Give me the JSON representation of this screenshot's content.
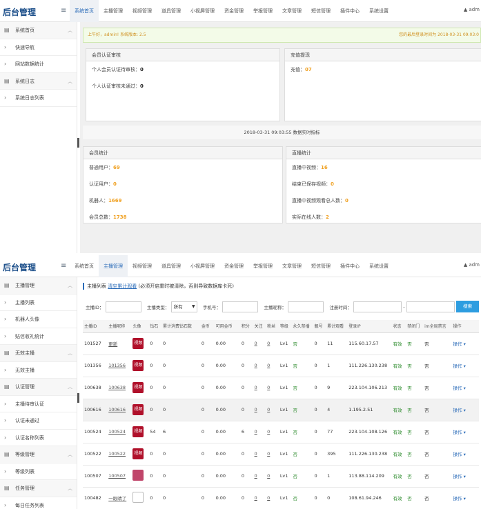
{
  "shot1": {
    "brand": "后台管理",
    "menu_icon": "hamburger-icon",
    "tabs": [
      "系统首页",
      "主播管理",
      "视频管理",
      "道具管理",
      "小视屏管理",
      "资金管理",
      "举报管理",
      "文章管理",
      "短信管理",
      "插件中心",
      "系统设置"
    ],
    "active_tab": 0,
    "user": "adm",
    "sidebar": [
      {
        "label": "系统首页",
        "type": "group",
        "icon": "doc-icon",
        "caret": "^"
      },
      {
        "label": "快速导航",
        "type": "item",
        "icon": ">"
      },
      {
        "label": "网站数据统计",
        "type": "item",
        "icon": ">"
      },
      {
        "label": "系统日志",
        "type": "group",
        "icon": "doc-icon",
        "caret": "^"
      },
      {
        "label": "系统日志列表",
        "type": "item",
        "icon": ">"
      }
    ],
    "notice_left": "上午好，admin! 系统版本: 2.5",
    "notice_right": "您的最后登录时间为 2018-03-31 09:03:0",
    "member_verify": {
      "title": "会员认证审核",
      "rows": [
        {
          "label": "个人会员认证待审核：",
          "value": "0"
        },
        {
          "label": "个人认证审核未通过：",
          "value": "0"
        }
      ]
    },
    "recharge": {
      "title": "充值提现",
      "label": "充值：",
      "value": "07"
    },
    "timestamp": "2018-03-31 09:03:55 数据实时指标",
    "member_stats": {
      "title": "会员统计",
      "rows": [
        {
          "label": "普通用户：",
          "value": "69"
        },
        {
          "label": "认证用户：",
          "value": "0"
        },
        {
          "label": "机器人：",
          "value": "1669"
        },
        {
          "label": "会员总数：",
          "value": "1738"
        }
      ]
    },
    "live_stats": {
      "title": "直播统计",
      "rows": [
        {
          "label": "直播中视频：",
          "value": "16"
        },
        {
          "label": "结束已保存视频：",
          "value": "0"
        },
        {
          "label": "直播中视频观看总人数：",
          "value": "0"
        },
        {
          "label": "实际在线人数：",
          "value": "2"
        }
      ]
    }
  },
  "shot2": {
    "brand": "后台管理",
    "tabs": [
      "系统首页",
      "主播管理",
      "视频管理",
      "道具管理",
      "小视屏管理",
      "资金管理",
      "举报管理",
      "文章管理",
      "短信管理",
      "插件中心",
      "系统设置"
    ],
    "active_tab": 1,
    "user": "adm",
    "sidebar": [
      {
        "label": "主播管理",
        "type": "group",
        "icon": "doc-icon",
        "caret": "^"
      },
      {
        "label": "主播列表",
        "type": "item",
        "icon": ">"
      },
      {
        "label": "机器人头像",
        "type": "item",
        "icon": ">"
      },
      {
        "label": "贴信收礼统计",
        "type": "item",
        "icon": ">"
      },
      {
        "label": "无效主播",
        "type": "group",
        "icon": "doc-icon",
        "caret": "^"
      },
      {
        "label": "无效主播",
        "type": "item",
        "icon": ">"
      },
      {
        "label": "认证管理",
        "type": "group",
        "icon": "doc-icon",
        "caret": "^"
      },
      {
        "label": "主播待审认证",
        "type": "item",
        "icon": ">"
      },
      {
        "label": "认证未通过",
        "type": "item",
        "icon": ">"
      },
      {
        "label": "认证名称列表",
        "type": "item",
        "icon": ">"
      },
      {
        "label": "等级管理",
        "type": "group",
        "icon": "doc-icon",
        "caret": "^"
      },
      {
        "label": "等级列表",
        "type": "item",
        "icon": ">"
      },
      {
        "label": "任务管理",
        "type": "group",
        "icon": "doc-icon",
        "caret": "^"
      },
      {
        "label": "每日任务列表",
        "type": "item",
        "icon": ">"
      }
    ],
    "crumb_label": "主播列表",
    "crumb_link": "清空累计观看",
    "crumb_note": "(必须开启重时被清除，否则导致数据库卡死)",
    "filters": {
      "id_label": "主播ID：",
      "type_label": "主播类型：",
      "type_value": "所有",
      "phone_label": "手机号：",
      "nick_label": "主播昵称：",
      "time_label": "注册时间：",
      "dash": "-",
      "search_button": "搜索"
    },
    "columns": [
      "主播ID",
      "主播昵称",
      "头像",
      "钻石",
      "累计消费钻石数",
      "金币",
      "可用金币",
      "积分",
      "关注",
      "粉丝",
      "等级",
      "永久禁播",
      "靓号",
      "累计观看",
      "登录IP",
      "状态",
      "禁闭门",
      "im全局禁言",
      "操作"
    ],
    "rows": [
      {
        "id": "101527",
        "nick": "更新",
        "avatar": "app",
        "diamonds": "0",
        "spent": "0",
        "coins": "0",
        "avail": "0.00",
        "points": "0",
        "follow": "0",
        "fans": "0",
        "level": "Lv1",
        "ban": "否",
        "pretty": "0",
        "views": "11",
        "ip": "115.60.17.57",
        "status": "有效",
        "door": "否",
        "im": "否",
        "op": "操作"
      },
      {
        "id": "101356",
        "nick": "101356",
        "avatar": "app",
        "diamonds": "0",
        "spent": "0",
        "coins": "0",
        "avail": "0.00",
        "points": "0",
        "follow": "0",
        "fans": "0",
        "level": "Lv1",
        "ban": "否",
        "pretty": "0",
        "views": "1",
        "ip": "111.226.130.238",
        "status": "有效",
        "door": "否",
        "im": "否",
        "op": "操作"
      },
      {
        "id": "100638",
        "nick": "100638",
        "avatar": "app",
        "diamonds": "0",
        "spent": "0",
        "coins": "0",
        "avail": "0.00",
        "points": "0",
        "follow": "0",
        "fans": "0",
        "level": "Lv1",
        "ban": "否",
        "pretty": "0",
        "views": "9",
        "ip": "223.104.106.213",
        "status": "有效",
        "door": "否",
        "im": "否",
        "op": "操作"
      },
      {
        "id": "100616",
        "nick": "100616",
        "avatar": "app",
        "diamonds": "0",
        "spent": "0",
        "coins": "0",
        "avail": "0.00",
        "points": "0",
        "follow": "0",
        "fans": "0",
        "level": "Lv1",
        "ban": "否",
        "pretty": "0",
        "views": "4",
        "ip": "1.195.2.51",
        "status": "有效",
        "door": "否",
        "im": "否",
        "op": "操作"
      },
      {
        "id": "100524",
        "nick": "100524",
        "avatar": "app",
        "diamonds": "54",
        "spent": "6",
        "coins": "0",
        "avail": "0.00",
        "points": "6",
        "follow": "0",
        "fans": "0",
        "level": "Lv1",
        "ban": "否",
        "pretty": "0",
        "views": "77",
        "ip": "223.104.108.126",
        "status": "有效",
        "door": "否",
        "im": "否",
        "op": "操作"
      },
      {
        "id": "100522",
        "nick": "100522",
        "avatar": "app",
        "diamonds": "0",
        "spent": "0",
        "coins": "0",
        "avail": "0.00",
        "points": "0",
        "follow": "0",
        "fans": "0",
        "level": "Lv1",
        "ban": "否",
        "pretty": "0",
        "views": "395",
        "ip": "111.226.130.238",
        "status": "有效",
        "door": "否",
        "im": "否",
        "op": "操作"
      },
      {
        "id": "100507",
        "nick": "100507",
        "avatar": "pink",
        "diamonds": "0",
        "spent": "0",
        "coins": "0",
        "avail": "0.00",
        "points": "0",
        "follow": "0",
        "fans": "0",
        "level": "Lv1",
        "ban": "否",
        "pretty": "0",
        "views": "1",
        "ip": "113.88.114.209",
        "status": "有效",
        "door": "否",
        "im": "否",
        "op": "操作"
      },
      {
        "id": "100482",
        "nick": "一眼晴了",
        "avatar": "broken",
        "diamonds": "0",
        "spent": "0",
        "coins": "0",
        "avail": "0.00",
        "points": "0",
        "follow": "0",
        "fans": "0",
        "level": "Lv1",
        "ban": "否",
        "pretty": "0",
        "views": "0",
        "ip": "108.61.94.246",
        "status": "有效",
        "door": "否",
        "im": "否",
        "op": "操作"
      }
    ],
    "avatar_text": "视频"
  },
  "colors": {
    "brand": "#1c4f8a",
    "accent": "#2a6bb8",
    "orange": "#f0a020",
    "green": "#2a8a2a",
    "button": "#2d9de0"
  }
}
